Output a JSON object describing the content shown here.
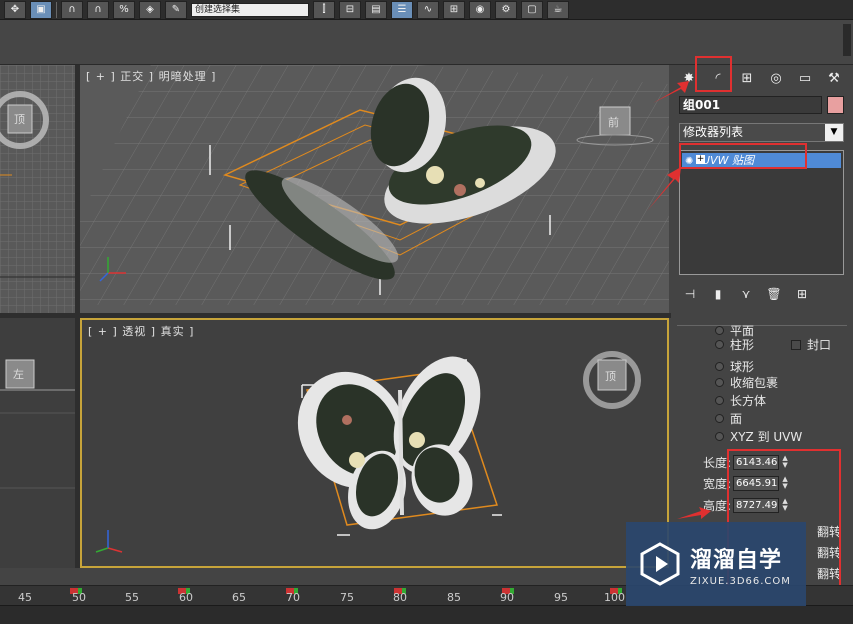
{
  "toolbar": {
    "select_filter": "创建选择集"
  },
  "viewports": {
    "front": {
      "label": "[ + ] 正交 ] 明暗处理 ]",
      "nav_cube": "前"
    },
    "perspective": {
      "label": "[ + ] 透视 ] 真实 ]",
      "nav_cube": "顶"
    },
    "top_left": {
      "nav_cube": "顶"
    },
    "left": {
      "nav_cube": "左"
    }
  },
  "command_panel": {
    "object_name": "组001",
    "modifier_list": "修改器列表",
    "stack_item": "UVW 贴图",
    "mapping_options": [
      "平面",
      "柱形",
      "球形",
      "收缩包裹",
      "长方体",
      "面",
      "XYZ 到 UVW"
    ],
    "cap_label": "封口",
    "length_label": "长度:",
    "length_value": "6143.46",
    "width_label": "宽度:",
    "width_value": "6645.91",
    "height_label": "高度:",
    "height_value": "8727.49",
    "flip_label": "翻转"
  },
  "timeline": {
    "ticks": [
      "45",
      "50",
      "55",
      "60",
      "65",
      "70",
      "75",
      "80",
      "85",
      "90",
      "95",
      "100"
    ]
  },
  "watermark": {
    "title": "溜溜自学",
    "url": "ZIXUE.3D66.COM"
  },
  "colors": {
    "accent_red": "#e03030",
    "selection_blue": "#4f8ad6",
    "active_viewport_border": "#c7a43a",
    "bounding_orange": "#e08a1e"
  }
}
